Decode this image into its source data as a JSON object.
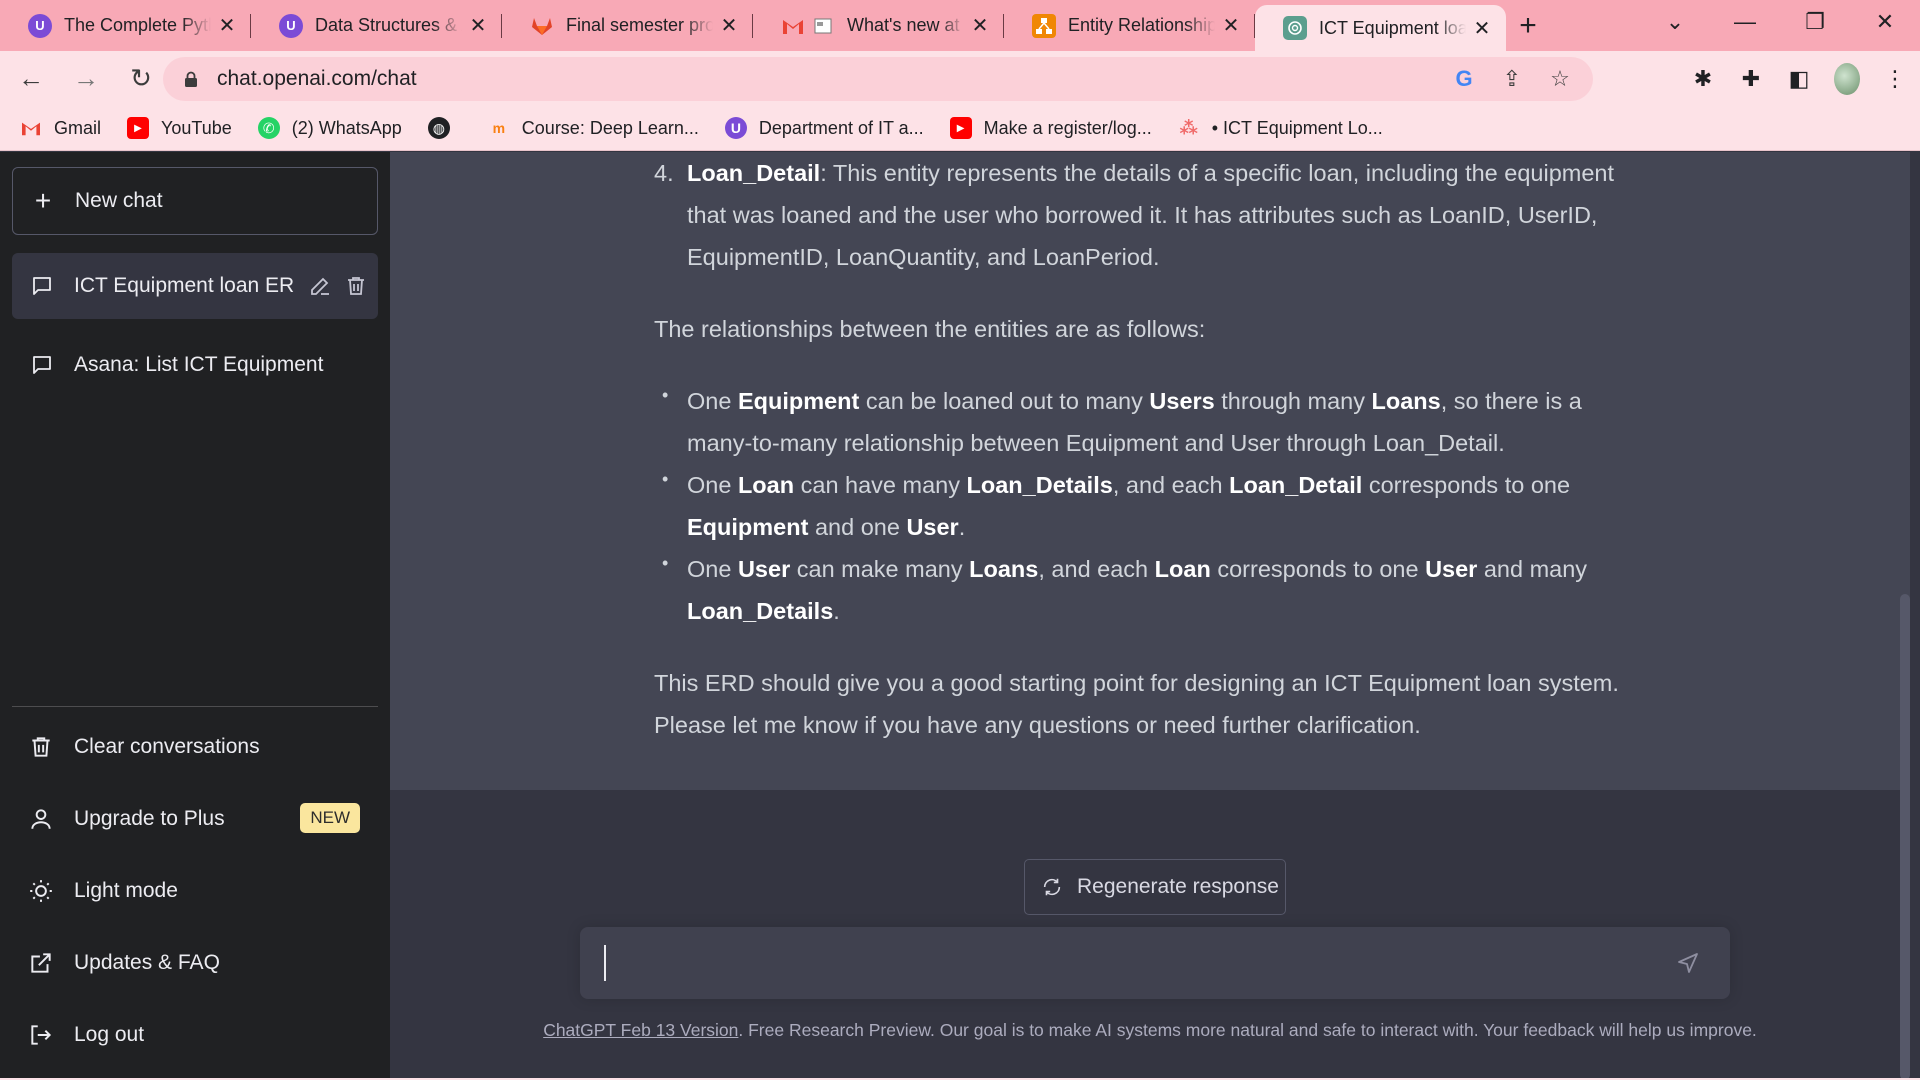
{
  "browser": {
    "tabs": [
      {
        "title": "The Complete Python",
        "icon": "udemy-icon"
      },
      {
        "title": "Data Structures & Algorithms",
        "icon": "udemy-icon"
      },
      {
        "title": "Final semester project",
        "icon": "gitlab-icon"
      },
      {
        "title": "What's new at M",
        "icon": "gmail-icon"
      },
      {
        "title": "Entity Relationship",
        "icon": "drawio-icon"
      },
      {
        "title": "ICT Equipment loan",
        "icon": "chatgpt-icon",
        "active": true
      }
    ],
    "url": "chat.openai.com/chat",
    "bookmarks": [
      {
        "label": "Gmail",
        "icon": "gmail-icon"
      },
      {
        "label": "YouTube",
        "icon": "youtube-icon"
      },
      {
        "label": "(2) WhatsApp",
        "icon": "whatsapp-icon"
      },
      {
        "label": "",
        "icon": "globe-icon"
      },
      {
        "label": "Course: Deep Learn...",
        "icon": "moodle-icon"
      },
      {
        "label": "Department of IT a...",
        "icon": "udemy-icon"
      },
      {
        "label": "Make a register/log...",
        "icon": "youtube-icon"
      },
      {
        "label": "• ICT Equipment Lo...",
        "icon": "asana-icon"
      }
    ]
  },
  "sidebar": {
    "new_chat": "New chat",
    "conversations": [
      {
        "title": "ICT Equipment loan ER",
        "active": true
      },
      {
        "title": "Asana: List ICT Equipment",
        "active": false
      }
    ],
    "clear": "Clear conversations",
    "upgrade": "Upgrade to Plus",
    "upgrade_badge": "NEW",
    "light_mode": "Light mode",
    "updates": "Updates & FAQ",
    "logout": "Log out"
  },
  "message": {
    "item4": {
      "number": "4.",
      "name": "Loan_Detail",
      "text": ": This entity represents the details of a specific loan, including the equipment that was loaned and the user who borrowed it. It has attributes such as LoanID, UserID, EquipmentID, LoanQuantity, and LoanPeriod."
    },
    "relationships_intro": "The relationships between the entities are as follows:",
    "bullet1": {
      "t1": "One ",
      "b1": "Equipment",
      "t2": " can be loaned out to many ",
      "b2": "Users",
      "t3": " through many ",
      "b3": "Loans",
      "t4": ", so there is a many-to-many relationship between Equipment and User through Loan_Detail."
    },
    "bullet2": {
      "t1": "One ",
      "b1": "Loan",
      "t2": " can have many ",
      "b2": "Loan_Details",
      "t3": ", and each ",
      "b3": "Loan_Detail",
      "t4": " corresponds to one ",
      "b4": "Equipment",
      "t5": " and one ",
      "b5": "User",
      "t6": "."
    },
    "bullet3": {
      "t1": "One ",
      "b1": "User",
      "t2": " can make many ",
      "b2": "Loans",
      "t3": ", and each ",
      "b3": "Loan",
      "t4": " corresponds to one ",
      "b4": "User",
      "t5": " and many ",
      "b5": "Loan_Details",
      "t6": "."
    },
    "closing": "This ERD should give you a good starting point for designing an ICT Equipment loan system. Please let me know if you have any questions or need further clarification."
  },
  "regenerate": "Regenerate response",
  "composer": {
    "value": ""
  },
  "footer": {
    "link": "ChatGPT Feb 13 Version",
    "text": ". Free Research Preview. Our goal is to make AI systems more natural and safe to interact with. Your feedback will help us improve."
  },
  "colors": {
    "tabbar": "#f8a9b6",
    "toolbar": "#fde2e7",
    "sidebar": "#202123",
    "main": "#343541",
    "message": "#444654",
    "badge": "#fae69e"
  }
}
